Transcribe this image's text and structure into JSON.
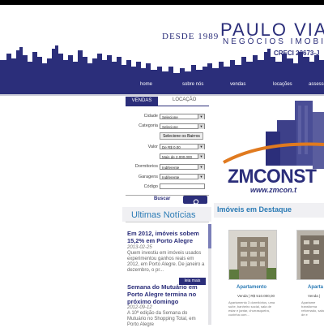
{
  "header": {
    "since": "DESDE 1989",
    "brand": "PAULO VIA",
    "tagline": "NEGÓCIOS IMOBIL",
    "creci": "CRECI 22673-J"
  },
  "nav": {
    "items": [
      "home",
      "sobre nós",
      "vendas",
      "locações",
      "assesso"
    ]
  },
  "search": {
    "tabs": [
      "VENDAS",
      "LOCAÇÃO"
    ],
    "fields": {
      "cidade": {
        "label": "Cidade",
        "value": "Selecione"
      },
      "categoria": {
        "label": "Categoria",
        "value": "Selecione"
      },
      "bairros_button": "Selecione os Bairros",
      "valor": {
        "label": "Valor",
        "min": "De R$ 0.00",
        "max": "Mais de 2.000.000"
      },
      "dormitorios": {
        "label": "Dormitorios",
        "value": "Indiferente"
      },
      "garagens": {
        "label": "Garagens",
        "value": "Indiferente"
      },
      "codigo": {
        "label": "Código",
        "value": ""
      }
    },
    "submit": "Buscar"
  },
  "news": {
    "heading": "Ultimas Notícias",
    "items": [
      {
        "title": "Em 2012, imóveis sobem 15,2% em Porto Alegre",
        "date": "2013-02-25",
        "text": "Quem investiu em imóveis usados experimentou ganhos reais em 2012, em Porto Alegre. De janeiro a dezembro, o pr..."
      },
      {
        "title": "Semana do Mutuário em Porto Alegre termina no próximo domingo",
        "date": "2012-09-12",
        "text": "A 10ª edição da Semana do Mutuário no Shopping Total, em Porto Alegre"
      }
    ],
    "read_more": "leia mais"
  },
  "banner": {
    "brand": "ZMCONST",
    "url": "www.zmcon.t"
  },
  "featured": {
    "heading": "Imóveis em Destaque",
    "cards": [
      {
        "name": "Apartamento",
        "price": "Venda | R$ 510.000,00",
        "desc": "Apartamento 3 dormitórios, uma suíte, banheiro social, sala de estar e jantar, churrasqueira, cozinha com..."
      },
      {
        "name": "Aparta",
        "price": "Venda |",
        "desc": "Apartame transforma reformado, sala de e"
      }
    ]
  },
  "colors": {
    "primary": "#2b2e7a",
    "accent": "#e07a1f",
    "link": "#2b7bb5"
  }
}
